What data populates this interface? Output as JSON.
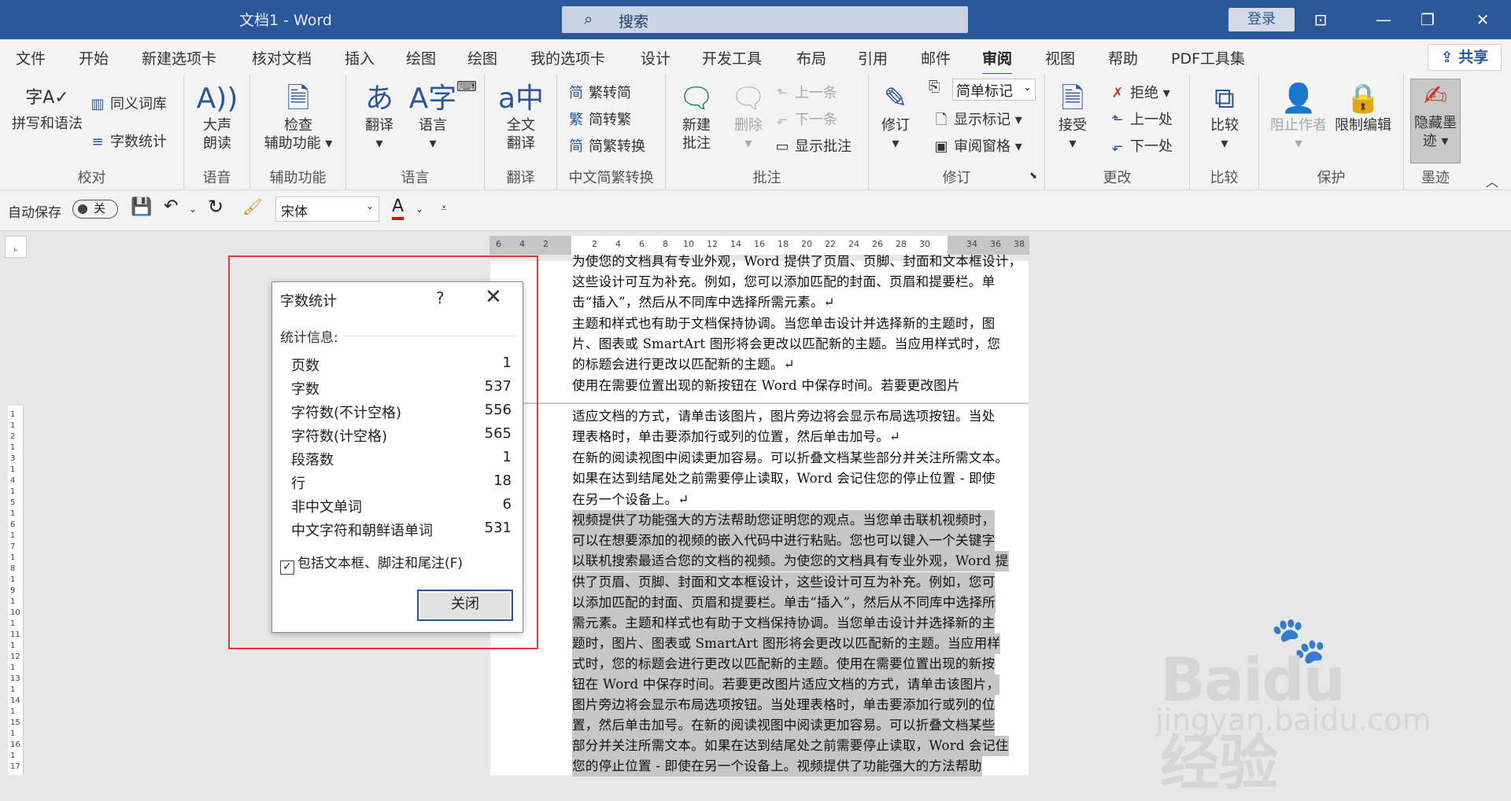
{
  "titlebar": {
    "title": "文档1 - Word",
    "search_placeholder": "搜索",
    "login": "登录",
    "ribbon_display_icon": "ribbon-display-icon",
    "minimize_icon": "minimize-icon",
    "restore_icon": "restore-icon",
    "close_icon": "close-icon"
  },
  "tabs": [
    "文件",
    "开始",
    "新建选项卡",
    "核对文档",
    "插入",
    "绘图",
    "绘图",
    "我的选项卡",
    "设计",
    "开发工具",
    "布局",
    "引用",
    "邮件",
    "审阅",
    "视图",
    "帮助",
    "PDF工具集"
  ],
  "active_tab": "审阅",
  "share": "共享",
  "ribbon": {
    "proofing": {
      "label": "校对",
      "spelling": "拼写和语法",
      "thesaurus": "同义词库",
      "wordcount": "字数统计"
    },
    "speech": {
      "label": "语音",
      "read_aloud_1": "大声",
      "read_aloud_2": "朗读"
    },
    "accessibility": {
      "label": "辅助功能",
      "check_1": "检查",
      "check_2": "辅助功能"
    },
    "language": {
      "label": "语言",
      "translate": "翻译",
      "language": "语言"
    },
    "translate": {
      "label": "翻译",
      "full_1": "全文",
      "full_2": "翻译"
    },
    "chinese": {
      "label": "中文简繁转换",
      "to_trad": "繁转简",
      "to_simp": "简转繁",
      "convert": "简繁转换"
    },
    "comments": {
      "label": "批注",
      "new_1": "新建",
      "new_2": "批注",
      "delete": "删除",
      "prev": "上一条",
      "next": "下一条",
      "show": "显示批注"
    },
    "tracking": {
      "label": "修订",
      "track": "修订",
      "markup_select": "简单标记",
      "show_markup": "显示标记",
      "pane": "审阅窗格"
    },
    "changes": {
      "label": "更改",
      "accept": "接受",
      "reject": "拒绝",
      "prev": "上一处",
      "next": "下一处"
    },
    "compare": {
      "label": "比较",
      "compare": "比较"
    },
    "protect": {
      "label": "保护",
      "block": "阻止作者",
      "restrict": "限制编辑"
    },
    "ink": {
      "label": "墨迹",
      "hide_1": "隐藏墨",
      "hide_2": "迹"
    }
  },
  "qat": {
    "autosave": "自动保存",
    "toggle": "关",
    "font": "宋体"
  },
  "ruler": {
    "h_labels": [
      "6",
      "4",
      "2",
      "2",
      "4",
      "6",
      "8",
      "10",
      "12",
      "14",
      "16",
      "18",
      "20",
      "22",
      "24",
      "26",
      "28",
      "30",
      "34",
      "36",
      "38"
    ],
    "v_labels": [
      "1",
      "1",
      "2",
      "1",
      "3",
      "1",
      "4",
      "1",
      "5",
      "1",
      "6",
      "1",
      "7",
      "1",
      "8",
      "1",
      "9",
      "1",
      "10",
      "1",
      "11",
      "1",
      "12",
      "1",
      "13",
      "1",
      "14",
      "1",
      "15",
      "1",
      "16",
      "1",
      "17"
    ]
  },
  "document": {
    "page1": [
      "为使您的文档具有专业外观，Word 提供了页眉、页脚、封面和文本框设计，",
      "这些设计可互为补充。例如，您可以添加匹配的封面、页眉和提要栏。单",
      "击“插入”，然后从不同库中选择所需元素。↵",
      "主题和样式也有助于文档保持协调。当您单击设计并选择新的主题时，图",
      "片、图表或 SmartArt 图形将会更改以匹配新的主题。当应用样式时，您",
      "的标题会进行更改以匹配新的主题。↵",
      "使用在需要位置出现的新按钮在 Word 中保存时间。若要更改图片"
    ],
    "page2": [
      "适应文档的方式，请单击该图片，图片旁边将会显示布局选项按钮。当处",
      "理表格时，单击要添加行或列的位置，然后单击加号。↵",
      "在新的阅读视图中阅读更加容易。可以折叠文档某些部分并关注所需文本。",
      "如果在达到结尾处之前需要停止读取，Word 会记住您的停止位置 - 即使",
      "在另一个设备上。↵"
    ],
    "selected": [
      "视频提供了功能强大的方法帮助您证明您的观点。当您单击联机视频时，",
      "可以在想要添加的视频的嵌入代码中进行粘贴。您也可以键入一个关键字",
      "以联机搜索最适合您的文档的视频。为使您的文档具有专业外观，Word 提",
      "供了页眉、页脚、封面和文本框设计，这些设计可互为补充。例如，您可",
      "以添加匹配的封面、页眉和提要栏。单击“插入”，然后从不同库中选择所",
      "需元素。主题和样式也有助于文档保持协调。当您单击设计并选择新的主",
      "题时，图片、图表或 SmartArt 图形将会更改以匹配新的主题。当应用样",
      "式时，您的标题会进行更改以匹配新的主题。使用在需要位置出现的新按",
      "钮在 Word 中保存时间。若要更改图片适应文档的方式，请单击该图片，",
      "图片旁边将会显示布局选项按钮。当处理表格时，单击要添加行或列的位",
      "置，然后单击加号。在新的阅读视图中阅读更加容易。可以折叠文档某些",
      "部分并关注所需文本。如果在达到结尾处之前需要停止读取，Word 会记住",
      "您的停止位置 - 即使在另一个设备上。视频提供了功能强大的方法帮助"
    ]
  },
  "dialog": {
    "title": "字数统计",
    "help": "?",
    "close_x": "✕",
    "section": "统计信息:",
    "rows": [
      {
        "label": "页数",
        "value": "1"
      },
      {
        "label": "字数",
        "value": "537"
      },
      {
        "label": "字符数(不计空格)",
        "value": "556"
      },
      {
        "label": "字符数(计空格)",
        "value": "565"
      },
      {
        "label": "段落数",
        "value": "1"
      },
      {
        "label": "行",
        "value": "18"
      },
      {
        "label": "非中文单词",
        "value": "6"
      },
      {
        "label": "中文字符和朝鲜语单词",
        "value": "531"
      }
    ],
    "checkbox_label": "包括文本框、脚注和尾注(F)",
    "checkbox_checked": true,
    "close_button": "关闭"
  },
  "watermark": {
    "brand": "Baidu",
    "cn": "经验",
    "url": "jingyan.baidu.com"
  },
  "colors": {
    "accent": "#2b579a",
    "highlight_box": "#e53935",
    "selection": "#c6c6c6"
  }
}
